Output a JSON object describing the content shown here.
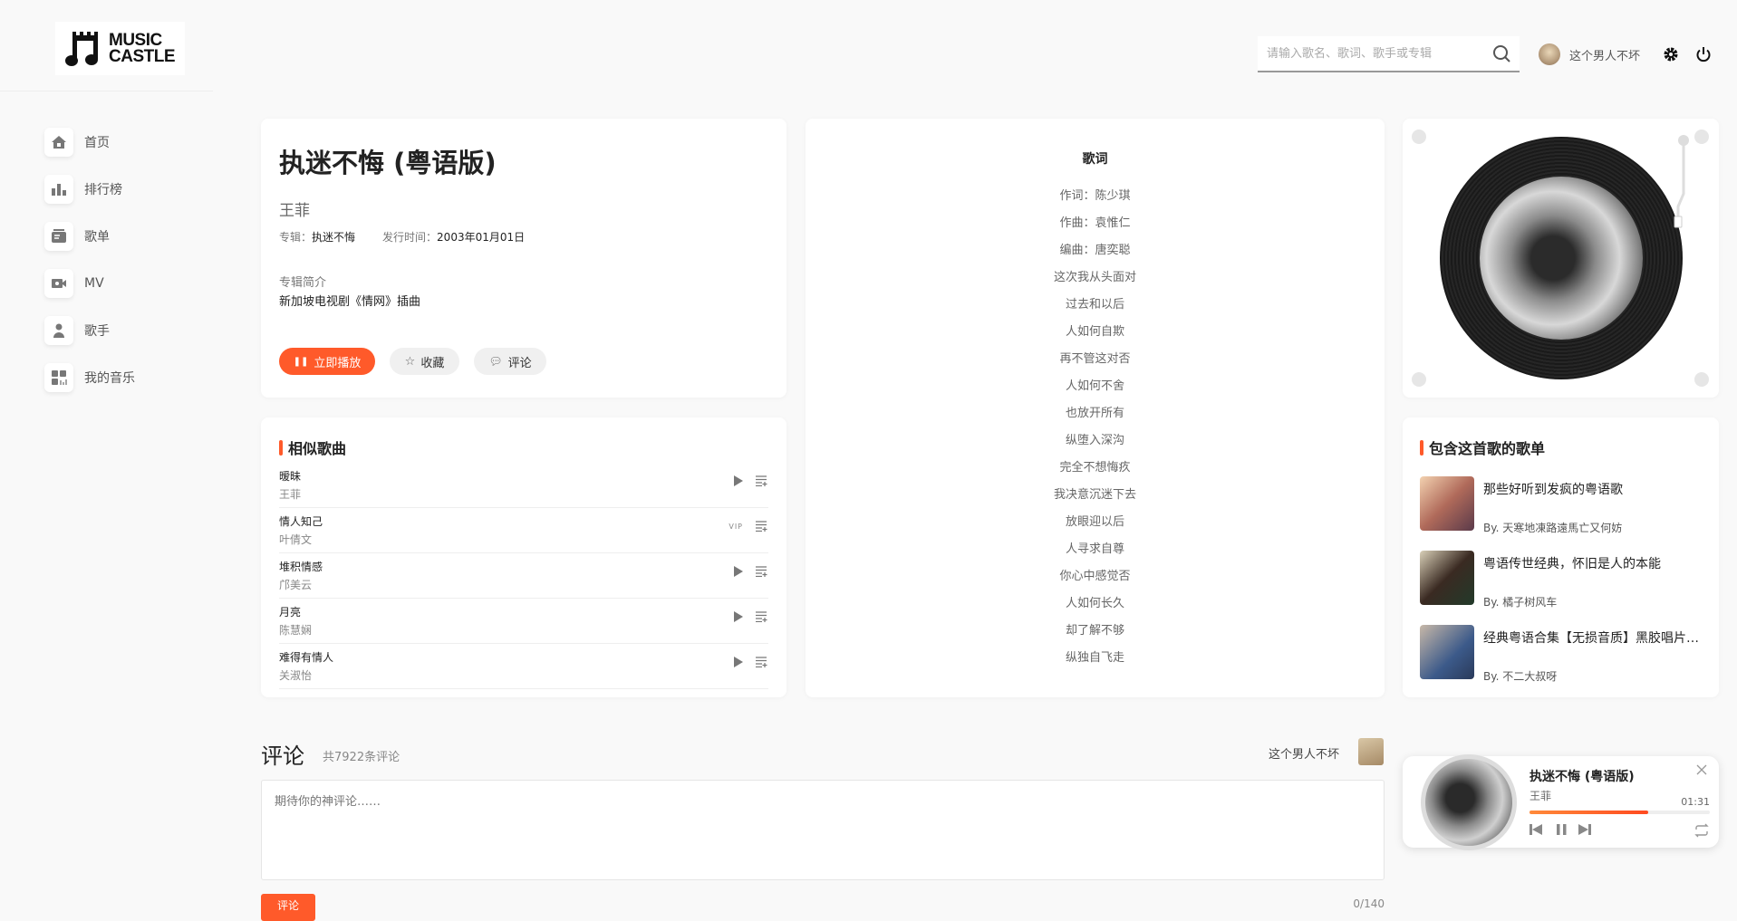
{
  "logo": {
    "line1": "MUSIC",
    "line2": "CASTLE"
  },
  "sidebar": {
    "items": [
      {
        "label": "首页",
        "icon": "home-icon"
      },
      {
        "label": "排行榜",
        "icon": "chart-icon"
      },
      {
        "label": "歌单",
        "icon": "playlist-icon"
      },
      {
        "label": "MV",
        "icon": "video-icon"
      },
      {
        "label": "歌手",
        "icon": "singer-icon"
      },
      {
        "label": "我的音乐",
        "icon": "grid-icon"
      }
    ]
  },
  "header": {
    "search_placeholder": "请输入歌名、歌词、歌手或专辑",
    "username": "这个男人不坏"
  },
  "song": {
    "title": "执迷不悔 (粤语版)",
    "artist": "王菲",
    "album_label": "专辑：",
    "album": "执迷不悔",
    "release_label": "发行时间：",
    "release": "2003年01月01日",
    "intro_label": "专辑简介",
    "intro": "新加坡电视剧《情网》插曲",
    "play_label": "立即播放",
    "collect_label": "收藏",
    "comment_label": "评论"
  },
  "similar": {
    "title": "相似歌曲",
    "items": [
      {
        "name": "暧昧",
        "artist": "王菲",
        "vip": false
      },
      {
        "name": "情人知己",
        "artist": "叶倩文",
        "vip": true,
        "badge": "VIP"
      },
      {
        "name": "堆积情感",
        "artist": "邝美云",
        "vip": false
      },
      {
        "name": "月亮",
        "artist": "陈慧娴",
        "vip": false
      },
      {
        "name": "难得有情人",
        "artist": "关淑怡",
        "vip": false
      }
    ]
  },
  "lyrics": {
    "title": "歌词",
    "lines": [
      "作词：陈少琪",
      "作曲：袁惟仁",
      "编曲：唐奕聪",
      "这次我从头面对",
      "过去和以后",
      "人如何自欺",
      "再不管这对否",
      "人如何不舍",
      "也放开所有",
      "纵堕入深沟",
      "完全不想悔疚",
      "我决意沉迷下去",
      "放眼迎以后",
      "人寻求自尊",
      "你心中感觉否",
      "人如何长久",
      "却了解不够",
      "纵独自飞走"
    ]
  },
  "playlists": {
    "title": "包含这首歌的歌单",
    "items": [
      {
        "title": "那些好听到发疯的粤语歌",
        "by": "By. 天寒地凍路遠馬亡又何妨"
      },
      {
        "title": "粤语传世经典，怀旧是人的本能",
        "by": "By. 橘子树风车"
      },
      {
        "title": "经典粤语合集【无损音质】黑胶唱片…",
        "by": "By. 不二大叔呀"
      }
    ]
  },
  "comments": {
    "title": "评论",
    "count": "共7922条评论",
    "username": "这个男人不坏",
    "placeholder": "期待你的神评论……",
    "submit": "评论",
    "counter": "0/140"
  },
  "player": {
    "title": "执迷不悔 (粤语版)",
    "artist": "王菲",
    "time": "01:31",
    "progress": 0.66
  },
  "colors": {
    "accent": "#ff5a2a",
    "background": "#f9f9f9"
  }
}
